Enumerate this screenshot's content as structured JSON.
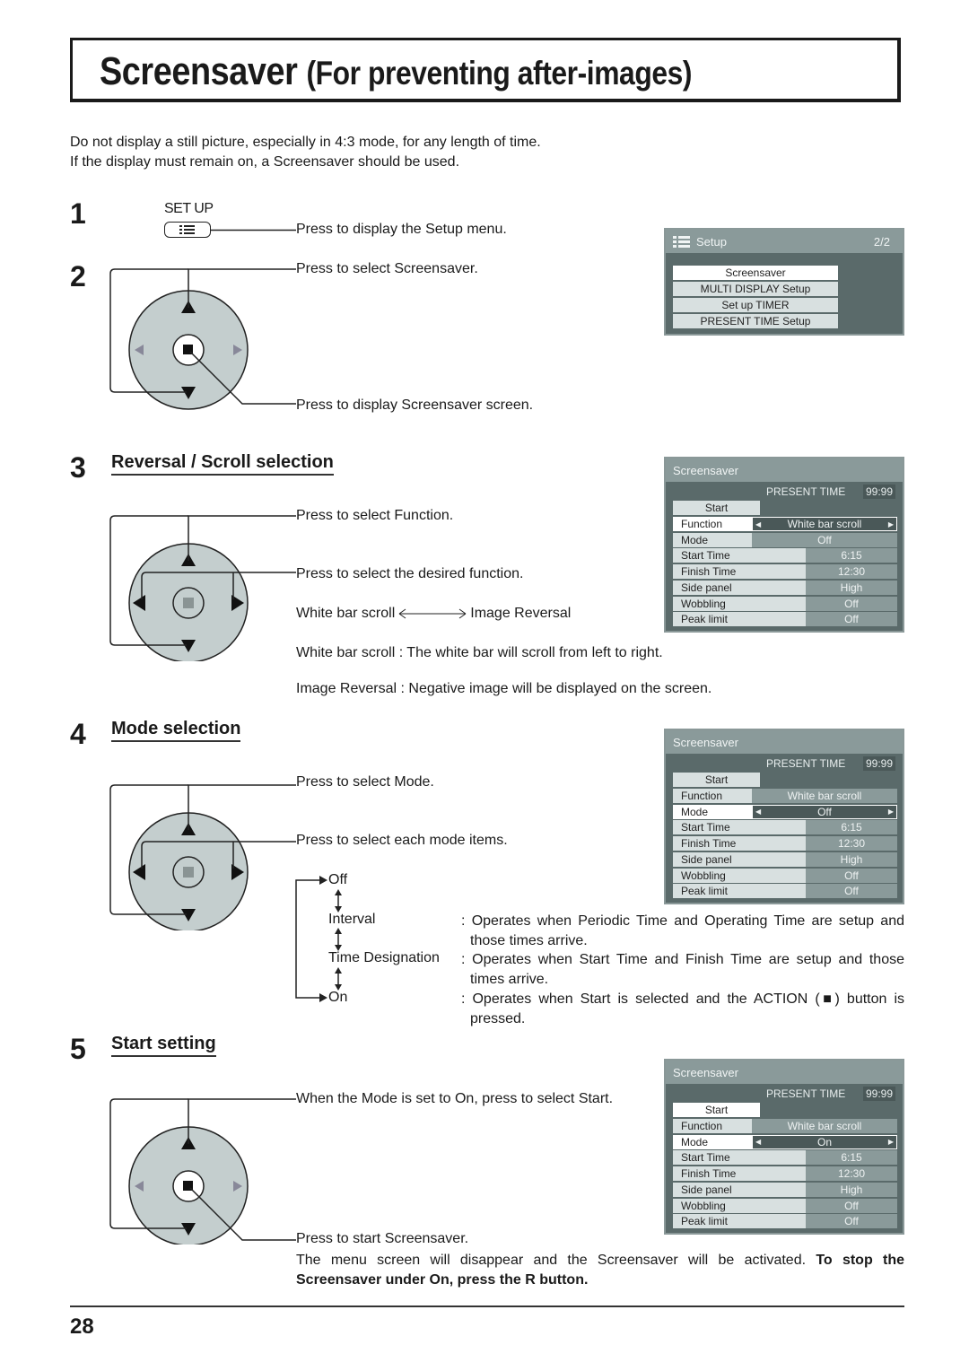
{
  "title": {
    "main": "Screensaver",
    "sub": "(For preventing after-images)"
  },
  "intro": [
    "Do not display a still picture, especially in 4:3 mode, for any length of time.",
    "If the display must remain on, a Screensaver should be used."
  ],
  "steps": {
    "s1": {
      "num": "1",
      "button_label": "SET UP",
      "button_icon": "menu-list-icon",
      "text": "Press to display the Setup menu."
    },
    "s2": {
      "num": "2",
      "text_select": "Press to select Screensaver.",
      "text_display": "Press to display Screensaver screen."
    },
    "s3": {
      "num": "3",
      "heading": "Reversal / Scroll selection",
      "text_select": "Press to select Function.",
      "text_desired": "Press to select the desired function.",
      "cycle_left": "White bar scroll",
      "cycle_right": "Image Reversal",
      "desc1": "White bar scroll : The white bar will scroll from left to right.",
      "desc2": "Image Reversal : Negative image will be displayed on the screen."
    },
    "s4": {
      "num": "4",
      "heading": "Mode selection",
      "text_select": "Press to select Mode.",
      "text_each": "Press to select each mode items.",
      "modes": [
        {
          "name": "Off",
          "desc": ""
        },
        {
          "name": "Interval",
          "desc": ": Operates when Periodic Time and Operating Time are setup and those times arrive."
        },
        {
          "name": "Time Designation",
          "desc": ": Operates when Start Time and Finish Time are setup and those times arrive."
        },
        {
          "name": "On",
          "desc": ": Operates when Start is selected and the ACTION (■) button is pressed."
        }
      ]
    },
    "s5": {
      "num": "5",
      "heading": "Start setting",
      "text_select": "When the Mode is set to On, press to select Start.",
      "text_start": "Press to start Screensaver.",
      "note_normal": "The menu screen will disappear and the Screensaver will be activated. ",
      "note_bold": "To stop the Screensaver under On, press the R button."
    }
  },
  "setup_menu": {
    "title": "Setup",
    "page": "2/2",
    "items": [
      "Screensaver",
      "MULTI DISPLAY Setup",
      "Set up TIMER",
      "PRESENT TIME Setup"
    ],
    "selected": "Screensaver"
  },
  "screensaver_menus": [
    {
      "title": "Screensaver",
      "present_time_label": "PRESENT  TIME",
      "present_time": "99:99",
      "start": "Start",
      "rows": [
        {
          "label": "Function",
          "value": "White bar scroll"
        },
        {
          "label": "Mode",
          "value": "Off"
        },
        {
          "label": "Start Time",
          "value": "6:15"
        },
        {
          "label": "Finish Time",
          "value": "12:30"
        },
        {
          "label": "Side panel",
          "value": "High"
        },
        {
          "label": "Wobbling",
          "value": "Off"
        },
        {
          "label": "Peak limit",
          "value": "Off"
        }
      ],
      "selected": "Function"
    },
    {
      "title": "Screensaver",
      "present_time_label": "PRESENT  TIME",
      "present_time": "99:99",
      "start": "Start",
      "rows": [
        {
          "label": "Function",
          "value": "White bar scroll"
        },
        {
          "label": "Mode",
          "value": "Off"
        },
        {
          "label": "Start Time",
          "value": "6:15"
        },
        {
          "label": "Finish Time",
          "value": "12:30"
        },
        {
          "label": "Side panel",
          "value": "High"
        },
        {
          "label": "Wobbling",
          "value": "Off"
        },
        {
          "label": "Peak limit",
          "value": "Off"
        }
      ],
      "selected": "Mode"
    },
    {
      "title": "Screensaver",
      "present_time_label": "PRESENT  TIME",
      "present_time": "99:99",
      "start": "Start",
      "rows": [
        {
          "label": "Function",
          "value": "White bar scroll"
        },
        {
          "label": "Mode",
          "value": "On"
        },
        {
          "label": "Start Time",
          "value": "6:15"
        },
        {
          "label": "Finish Time",
          "value": "12:30"
        },
        {
          "label": "Side panel",
          "value": "High"
        },
        {
          "label": "Wobbling",
          "value": "Off"
        },
        {
          "label": "Peak limit",
          "value": "Off"
        }
      ],
      "selected": "Mode"
    }
  ],
  "page_number": "28"
}
